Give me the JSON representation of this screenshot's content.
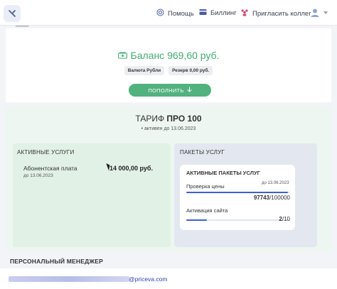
{
  "header": {
    "help_label": "Помощь",
    "billing_label": "Биллинг",
    "invite_label": "Пригласить коллег"
  },
  "balance": {
    "text": "Баланс 969,60 руб.",
    "currency_label": "Валюта Рубли",
    "reserve_label": "Резерв 0,00 руб.",
    "topup_label": "ПОПОЛНИТЬ",
    "accent": "#3fae6f"
  },
  "tariff": {
    "prefix": "ТАРИФ",
    "name": "ПРО 100",
    "status": "активен до 13.06.2023"
  },
  "active_services": {
    "heading": "АКТИВНЫЕ УСЛУГИ",
    "items": [
      {
        "name": "Абонентская плата",
        "date": "до 13.06.2023",
        "price": "14 000,00 руб."
      }
    ]
  },
  "service_packs": {
    "heading": "ПАКЕТЫ УСЛУГ",
    "card_heading": "АКТИВНЫЕ ПАКЕТЫ УСЛУГ",
    "items": [
      {
        "label": "Проверка цены",
        "date": "до 13.06.2023",
        "used": "97743",
        "limit": "/100000",
        "progress": 0.977
      },
      {
        "label": "Активация сайта",
        "used": "2",
        "limit": "/10",
        "progress": 0.2
      }
    ]
  },
  "manager": {
    "heading": "ПЕРСОНАЛЬНЫЙ МЕНЕДЖЕР",
    "email_visible": "@priceva.com"
  },
  "colors": {
    "progress": "#3c5fd3",
    "email": "#2e44b8"
  }
}
